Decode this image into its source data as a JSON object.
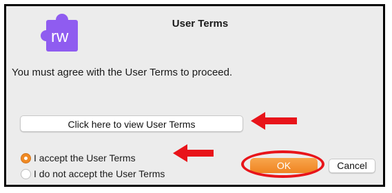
{
  "dialog": {
    "app_icon_text": "rw",
    "title": "User Terms",
    "message": "You must agree with the User Terms to proceed.",
    "view_terms_label": "Click here to view User Terms",
    "options": [
      {
        "label": "I accept the User Terms",
        "selected": true
      },
      {
        "label": "I do not accept the User Terms",
        "selected": false
      }
    ],
    "ok_label": "OK",
    "cancel_label": "Cancel"
  },
  "colors": {
    "accent": "#f08a24",
    "annotation": "#e8141a",
    "icon": "#8f5cf0"
  }
}
